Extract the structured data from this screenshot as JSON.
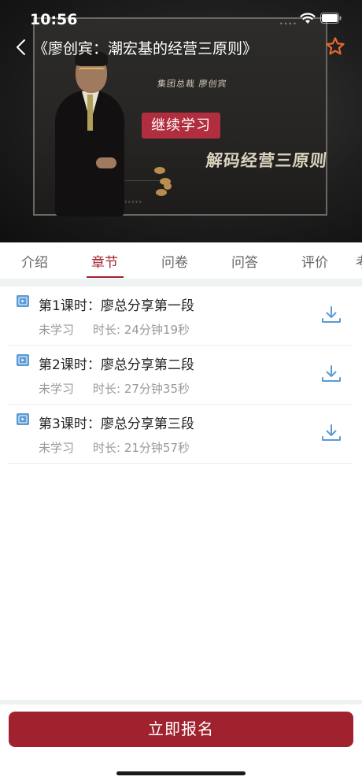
{
  "status_bar": {
    "time": "10:56"
  },
  "header": {
    "title": "《廖创宾：潮宏基的经营三原则》",
    "continue_label": "继续学习",
    "video_subtitle": "集团总裁 廖创宾",
    "video_caption": "解码经营三原则"
  },
  "tabs": [
    {
      "label": "介绍"
    },
    {
      "label": "章节"
    },
    {
      "label": "问卷"
    },
    {
      "label": "问答"
    },
    {
      "label": "评价"
    },
    {
      "label": "考"
    }
  ],
  "active_tab": "章节",
  "lessons": [
    {
      "title": "第1课时：廖总分享第一段",
      "status": "未学习",
      "duration": "时长: 24分钟19秒"
    },
    {
      "title": "第2课时：廖总分享第二段",
      "status": "未学习",
      "duration": "时长: 27分钟35秒"
    },
    {
      "title": "第3课时：廖总分享第三段",
      "status": "未学习",
      "duration": "时长: 21分钟57秒"
    }
  ],
  "footer": {
    "enroll_label": "立即报名"
  },
  "colors": {
    "accent": "#a1222f",
    "continue_bg": "#b12e3e",
    "star": "#e7692f",
    "icon_blue": "#5a9bd5"
  },
  "icons": [
    "back-icon",
    "star-icon",
    "wifi-icon",
    "battery-icon",
    "video-icon",
    "download-icon"
  ]
}
